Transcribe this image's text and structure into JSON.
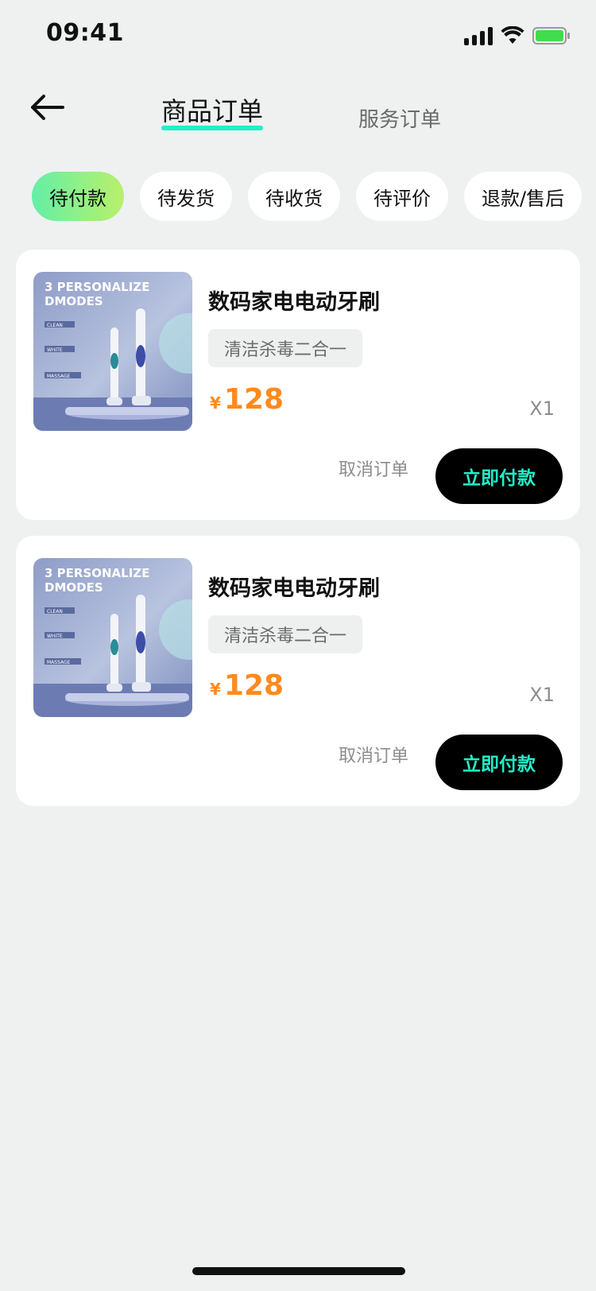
{
  "status_bar": {
    "time": "09:41"
  },
  "header": {
    "tabs": [
      {
        "label": "商品订单",
        "active": true
      },
      {
        "label": "服务订单",
        "active": false
      }
    ],
    "accent_color": "#21F0C7"
  },
  "filters": [
    {
      "label": "待付款",
      "active": true
    },
    {
      "label": "待发货",
      "active": false
    },
    {
      "label": "待收货",
      "active": false
    },
    {
      "label": "待评价",
      "active": false
    },
    {
      "label": "退款/售后",
      "active": false
    }
  ],
  "orders": [
    {
      "image": {
        "headline": "3 PERSONALIZE DMODES",
        "modes": [
          "CLEAN",
          "WHITE",
          "MASSAGE"
        ]
      },
      "title": "数码家电电动牙刷",
      "tag": "清洁杀毒二合一",
      "currency": "¥",
      "price": "128",
      "quantity": "X1",
      "cancel_label": "取消订单",
      "pay_label": "立即付款"
    },
    {
      "image": {
        "headline": "3 PERSONALIZE DMODES",
        "modes": [
          "CLEAN",
          "WHITE",
          "MASSAGE"
        ]
      },
      "title": "数码家电电动牙刷",
      "tag": "清洁杀毒二合一",
      "currency": "¥",
      "price": "128",
      "quantity": "X1",
      "cancel_label": "取消订单",
      "pay_label": "立即付款"
    }
  ],
  "colors": {
    "price": "#FF8A1F",
    "pay_button_bg": "#000000",
    "pay_button_text": "#21F0C7",
    "background": "#EEF1F0"
  }
}
